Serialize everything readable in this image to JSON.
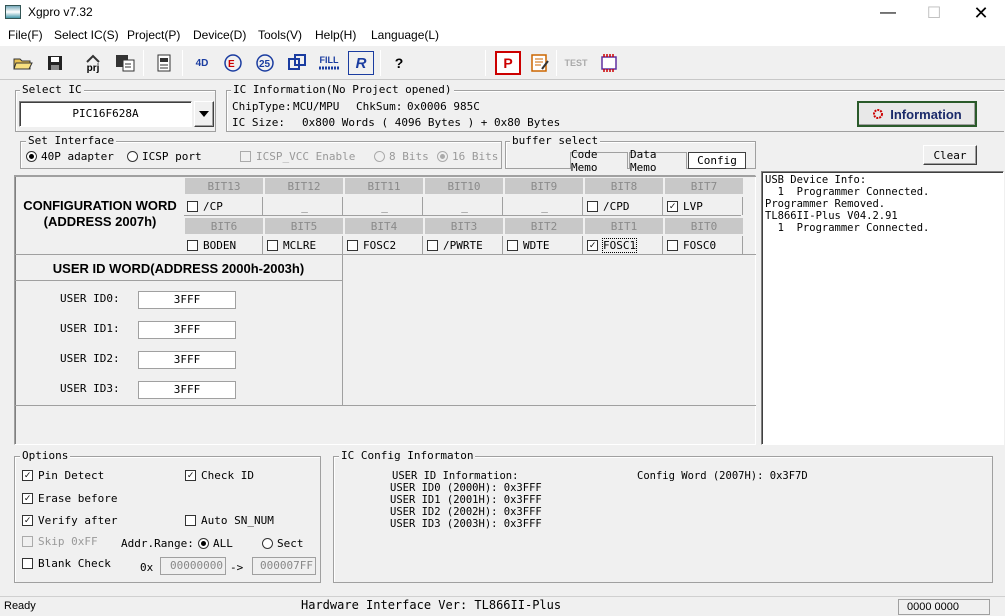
{
  "window": {
    "title": "Xgpro v7.32"
  },
  "menu": [
    "File(F)",
    "Select IC(S)",
    "Project(P)",
    "Device(D)",
    "Tools(V)",
    "Help(H)",
    "Language(L)"
  ],
  "toolbar": {
    "prj_label": "prj",
    "fill_label": "FILL",
    "test_label": "TEST",
    "fourd_label": "4D",
    "r_label": "R",
    "p_label": "P",
    "q_label": "?"
  },
  "select_ic": {
    "title": "Select IC",
    "value": "PIC16F628A"
  },
  "ic_info": {
    "title": "IC Information(No Project opened)",
    "chiptype_label": "ChipType:",
    "chiptype": "MCU/MPU",
    "chksum_label": "ChkSum:",
    "chksum": "0x0006 985C",
    "size_label": "IC Size:",
    "size": "0x800 Words ( 4096 Bytes ) + 0x80 Bytes"
  },
  "information_button": "Information",
  "interface": {
    "title": "Set Interface",
    "opt1": "40P adapter",
    "opt2": "ICSP port",
    "icsp_vcc": "ICSP_VCC Enable",
    "bits8": "8 Bits",
    "bits16": "16 Bits"
  },
  "buffer": {
    "title": "buffer select",
    "tabs": [
      "Code Memo",
      "Data Memo",
      "Config"
    ]
  },
  "clear_button": "Clear",
  "config": {
    "title_line1": "CONFIGURATION WORD",
    "title_line2": "(ADDRESS 2007h)",
    "row1_headers": [
      "BIT13",
      "BIT12",
      "BIT11",
      "BIT10",
      "BIT9",
      "BIT8",
      "BIT7"
    ],
    "row1_cells": [
      {
        "label": "/CP",
        "checked": false,
        "dash": false
      },
      {
        "label": "_",
        "checked": false,
        "dash": true
      },
      {
        "label": "_",
        "checked": false,
        "dash": true
      },
      {
        "label": "_",
        "checked": false,
        "dash": true
      },
      {
        "label": "_",
        "checked": false,
        "dash": true
      },
      {
        "label": "/CPD",
        "checked": false,
        "dash": false
      },
      {
        "label": "LVP",
        "checked": true,
        "dash": false
      }
    ],
    "row2_headers": [
      "BIT6",
      "BIT5",
      "BIT4",
      "BIT3",
      "BIT2",
      "BIT1",
      "BIT0"
    ],
    "row2_cells": [
      {
        "label": "BODEN",
        "checked": false
      },
      {
        "label": "MCLRE",
        "checked": false
      },
      {
        "label": "FOSC2",
        "checked": false
      },
      {
        "label": "/PWRTE",
        "checked": false
      },
      {
        "label": "WDTE",
        "checked": false
      },
      {
        "label": "FOSC1",
        "checked": true
      },
      {
        "label": "FOSC0",
        "checked": false
      }
    ]
  },
  "user_id": {
    "title": "USER ID WORD(ADDRESS 2000h-2003h)",
    "labels": [
      "USER ID0:",
      "USER ID1:",
      "USER ID2:",
      "USER ID3:"
    ],
    "values": [
      "3FFF",
      "3FFF",
      "3FFF",
      "3FFF"
    ]
  },
  "log": [
    "USB Device Info:",
    "  1  Programmer Connected.",
    "Programmer Removed.",
    "TL866II-Plus V04.2.91",
    "  1  Programmer Connected."
  ],
  "options": {
    "title": "Options",
    "pin_detect": "Pin Detect",
    "check_id": "Check ID",
    "erase_before": "Erase before",
    "verify_after": "Verify after",
    "auto_sn": "Auto SN_NUM",
    "skip_off": "Skip 0xFF",
    "blank_check": "Blank Check",
    "addr_range": "Addr.Range:",
    "all": "ALL",
    "sect": "Sect",
    "ox": "0x",
    "addr_from": "00000000",
    "arrow": "->",
    "addr_to": "000007FF"
  },
  "ic_config": {
    "title": "IC Config Informaton",
    "uid_header": "USER ID Information:",
    "uid_lines": [
      "USER ID0 (2000H): 0x3FFF",
      "USER ID1 (2001H): 0x3FFF",
      "USER ID2 (2002H): 0x3FFF",
      "USER ID3 (2003H): 0x3FFF"
    ],
    "config_word": "Config Word (2007H): 0x3F7D"
  },
  "status": {
    "ready": "Ready",
    "hw": "Hardware Interface Ver: TL866II-Plus",
    "addr": "0000 0000"
  }
}
